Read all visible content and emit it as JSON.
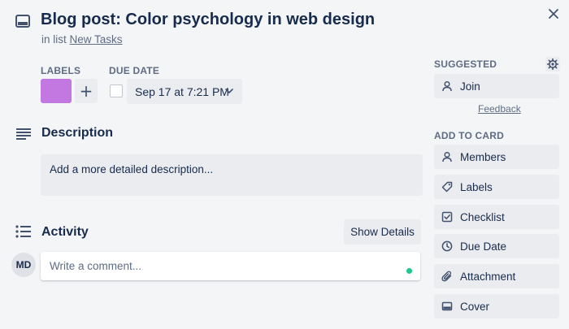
{
  "card": {
    "title": "Blog post: Color psychology in web design",
    "in_list_prefix": "in list",
    "list_name": "New Tasks"
  },
  "labels": {
    "heading": "LABELS",
    "color": "#c377e0",
    "add_symbol": "+"
  },
  "due_date": {
    "heading": "DUE DATE",
    "value": "Sep 17 at 7:21 PM"
  },
  "description": {
    "heading": "Description",
    "placeholder": "Add a more detailed description..."
  },
  "activity": {
    "heading": "Activity",
    "show_details": "Show Details",
    "avatar_initials": "MD",
    "comment_placeholder": "Write a comment..."
  },
  "sidebar": {
    "suggested_heading": "SUGGESTED",
    "join": "Join",
    "feedback": "Feedback",
    "add_to_card_heading": "ADD TO CARD",
    "items": [
      {
        "label": "Members",
        "icon": "person-icon"
      },
      {
        "label": "Labels",
        "icon": "tag-icon"
      },
      {
        "label": "Checklist",
        "icon": "checklist-icon"
      },
      {
        "label": "Due Date",
        "icon": "clock-icon"
      },
      {
        "label": "Attachment",
        "icon": "paperclip-icon"
      },
      {
        "label": "Cover",
        "icon": "cover-icon"
      }
    ]
  },
  "colors": {
    "background": "#f4f5f7",
    "button_bg": "#ebecf0",
    "text": "#172b4d",
    "muted": "#5e6c84",
    "online": "#1ac88d"
  }
}
